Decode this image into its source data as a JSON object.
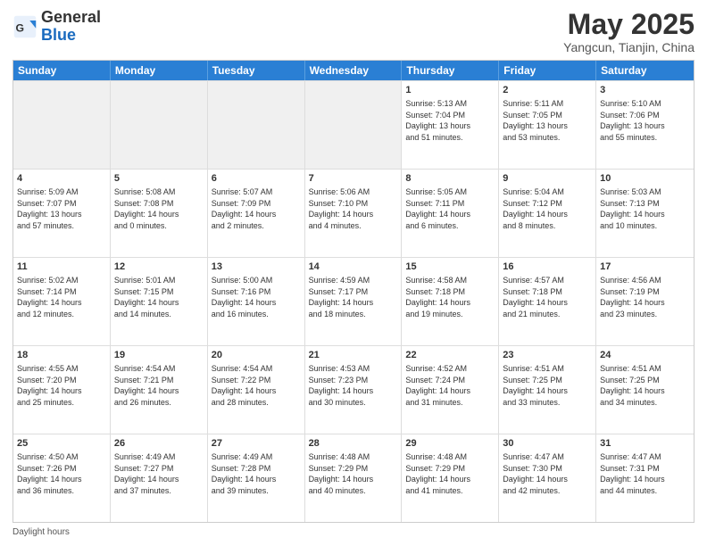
{
  "header": {
    "logo_general": "General",
    "logo_blue": "Blue",
    "month_title": "May 2025",
    "location": "Yangcun, Tianjin, China"
  },
  "days_of_week": [
    "Sunday",
    "Monday",
    "Tuesday",
    "Wednesday",
    "Thursday",
    "Friday",
    "Saturday"
  ],
  "footer_text": "Daylight hours",
  "rows": [
    [
      {
        "day": "",
        "info": "",
        "shaded": true
      },
      {
        "day": "",
        "info": "",
        "shaded": true
      },
      {
        "day": "",
        "info": "",
        "shaded": true
      },
      {
        "day": "",
        "info": "",
        "shaded": true
      },
      {
        "day": "1",
        "info": "Sunrise: 5:13 AM\nSunset: 7:04 PM\nDaylight: 13 hours\nand 51 minutes."
      },
      {
        "day": "2",
        "info": "Sunrise: 5:11 AM\nSunset: 7:05 PM\nDaylight: 13 hours\nand 53 minutes."
      },
      {
        "day": "3",
        "info": "Sunrise: 5:10 AM\nSunset: 7:06 PM\nDaylight: 13 hours\nand 55 minutes."
      }
    ],
    [
      {
        "day": "4",
        "info": "Sunrise: 5:09 AM\nSunset: 7:07 PM\nDaylight: 13 hours\nand 57 minutes."
      },
      {
        "day": "5",
        "info": "Sunrise: 5:08 AM\nSunset: 7:08 PM\nDaylight: 14 hours\nand 0 minutes."
      },
      {
        "day": "6",
        "info": "Sunrise: 5:07 AM\nSunset: 7:09 PM\nDaylight: 14 hours\nand 2 minutes."
      },
      {
        "day": "7",
        "info": "Sunrise: 5:06 AM\nSunset: 7:10 PM\nDaylight: 14 hours\nand 4 minutes."
      },
      {
        "day": "8",
        "info": "Sunrise: 5:05 AM\nSunset: 7:11 PM\nDaylight: 14 hours\nand 6 minutes."
      },
      {
        "day": "9",
        "info": "Sunrise: 5:04 AM\nSunset: 7:12 PM\nDaylight: 14 hours\nand 8 minutes."
      },
      {
        "day": "10",
        "info": "Sunrise: 5:03 AM\nSunset: 7:13 PM\nDaylight: 14 hours\nand 10 minutes."
      }
    ],
    [
      {
        "day": "11",
        "info": "Sunrise: 5:02 AM\nSunset: 7:14 PM\nDaylight: 14 hours\nand 12 minutes."
      },
      {
        "day": "12",
        "info": "Sunrise: 5:01 AM\nSunset: 7:15 PM\nDaylight: 14 hours\nand 14 minutes."
      },
      {
        "day": "13",
        "info": "Sunrise: 5:00 AM\nSunset: 7:16 PM\nDaylight: 14 hours\nand 16 minutes."
      },
      {
        "day": "14",
        "info": "Sunrise: 4:59 AM\nSunset: 7:17 PM\nDaylight: 14 hours\nand 18 minutes."
      },
      {
        "day": "15",
        "info": "Sunrise: 4:58 AM\nSunset: 7:18 PM\nDaylight: 14 hours\nand 19 minutes."
      },
      {
        "day": "16",
        "info": "Sunrise: 4:57 AM\nSunset: 7:18 PM\nDaylight: 14 hours\nand 21 minutes."
      },
      {
        "day": "17",
        "info": "Sunrise: 4:56 AM\nSunset: 7:19 PM\nDaylight: 14 hours\nand 23 minutes."
      }
    ],
    [
      {
        "day": "18",
        "info": "Sunrise: 4:55 AM\nSunset: 7:20 PM\nDaylight: 14 hours\nand 25 minutes."
      },
      {
        "day": "19",
        "info": "Sunrise: 4:54 AM\nSunset: 7:21 PM\nDaylight: 14 hours\nand 26 minutes."
      },
      {
        "day": "20",
        "info": "Sunrise: 4:54 AM\nSunset: 7:22 PM\nDaylight: 14 hours\nand 28 minutes."
      },
      {
        "day": "21",
        "info": "Sunrise: 4:53 AM\nSunset: 7:23 PM\nDaylight: 14 hours\nand 30 minutes."
      },
      {
        "day": "22",
        "info": "Sunrise: 4:52 AM\nSunset: 7:24 PM\nDaylight: 14 hours\nand 31 minutes."
      },
      {
        "day": "23",
        "info": "Sunrise: 4:51 AM\nSunset: 7:25 PM\nDaylight: 14 hours\nand 33 minutes."
      },
      {
        "day": "24",
        "info": "Sunrise: 4:51 AM\nSunset: 7:25 PM\nDaylight: 14 hours\nand 34 minutes."
      }
    ],
    [
      {
        "day": "25",
        "info": "Sunrise: 4:50 AM\nSunset: 7:26 PM\nDaylight: 14 hours\nand 36 minutes."
      },
      {
        "day": "26",
        "info": "Sunrise: 4:49 AM\nSunset: 7:27 PM\nDaylight: 14 hours\nand 37 minutes."
      },
      {
        "day": "27",
        "info": "Sunrise: 4:49 AM\nSunset: 7:28 PM\nDaylight: 14 hours\nand 39 minutes."
      },
      {
        "day": "28",
        "info": "Sunrise: 4:48 AM\nSunset: 7:29 PM\nDaylight: 14 hours\nand 40 minutes."
      },
      {
        "day": "29",
        "info": "Sunrise: 4:48 AM\nSunset: 7:29 PM\nDaylight: 14 hours\nand 41 minutes."
      },
      {
        "day": "30",
        "info": "Sunrise: 4:47 AM\nSunset: 7:30 PM\nDaylight: 14 hours\nand 42 minutes."
      },
      {
        "day": "31",
        "info": "Sunrise: 4:47 AM\nSunset: 7:31 PM\nDaylight: 14 hours\nand 44 minutes."
      }
    ]
  ]
}
